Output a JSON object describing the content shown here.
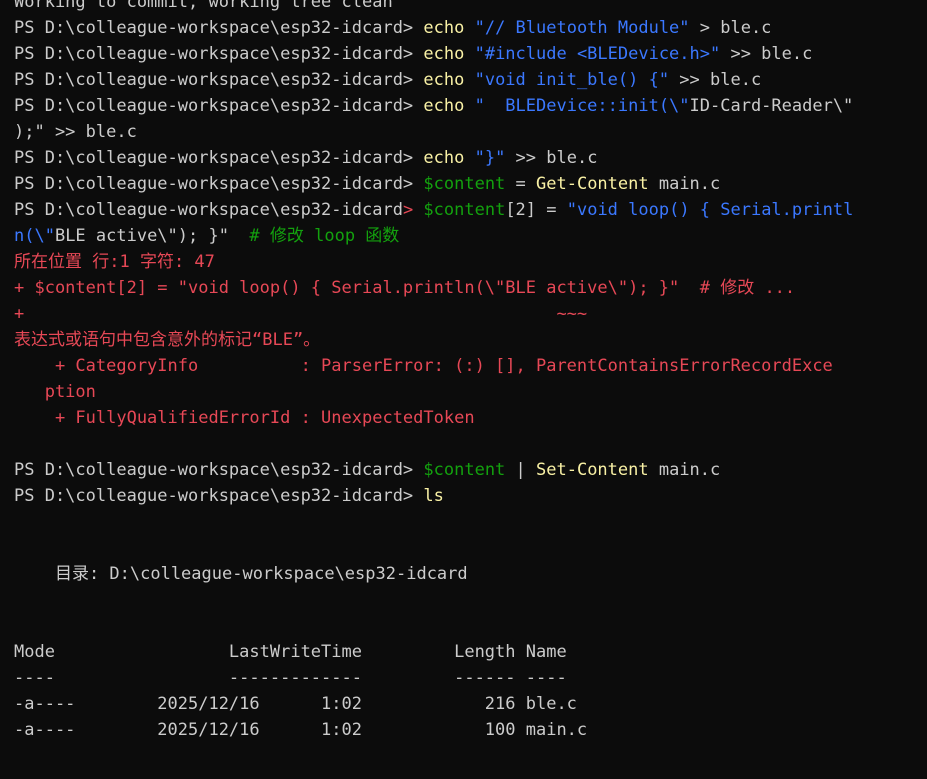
{
  "colors": {
    "background": "#0c0c0c",
    "text": "#cccccc",
    "command": "#f9f1a5",
    "string": "#3b78ff",
    "comment": "#13a10e",
    "error": "#e74856"
  },
  "lines": [
    [
      {
        "t": "Working to commit, working tree clean",
        "c": "w"
      }
    ],
    [
      {
        "t": "PS D:\\colleague-workspace\\esp32-idcard> ",
        "c": "w"
      },
      {
        "t": "echo",
        "c": "y"
      },
      {
        "t": " \"// Bluetooth Module\"",
        "c": "s"
      },
      {
        "t": " > ble.c",
        "c": "w"
      }
    ],
    [
      {
        "t": "PS D:\\colleague-workspace\\esp32-idcard> ",
        "c": "w"
      },
      {
        "t": "echo",
        "c": "y"
      },
      {
        "t": " \"#include <BLEDevice.h>\"",
        "c": "s"
      },
      {
        "t": " >> ble.c",
        "c": "w"
      }
    ],
    [
      {
        "t": "PS D:\\colleague-workspace\\esp32-idcard> ",
        "c": "w"
      },
      {
        "t": "echo",
        "c": "y"
      },
      {
        "t": " \"void init_ble() {\"",
        "c": "s"
      },
      {
        "t": " >> ble.c",
        "c": "w"
      }
    ],
    [
      {
        "t": "PS D:\\colleague-workspace\\esp32-idcard> ",
        "c": "w"
      },
      {
        "t": "echo",
        "c": "y"
      },
      {
        "t": " \"  BLEDevice::init(\\\"",
        "c": "s"
      },
      {
        "t": "ID-Card-Reader\\\"",
        "c": "w"
      }
    ],
    [
      {
        "t": ");\" >> ble.c",
        "c": "w"
      }
    ],
    [
      {
        "t": "PS D:\\colleague-workspace\\esp32-idcard> ",
        "c": "w"
      },
      {
        "t": "echo",
        "c": "y"
      },
      {
        "t": " \"}\"",
        "c": "s"
      },
      {
        "t": " >> ble.c",
        "c": "w"
      }
    ],
    [
      {
        "t": "PS D:\\colleague-workspace\\esp32-idcard> ",
        "c": "w"
      },
      {
        "t": "$content",
        "c": "g"
      },
      {
        "t": " = ",
        "c": "w"
      },
      {
        "t": "Get-Content",
        "c": "y"
      },
      {
        "t": " main.c",
        "c": "w"
      }
    ],
    [
      {
        "t": "PS D:\\colleague-workspace\\esp32-idcard",
        "c": "w"
      },
      {
        "t": "> ",
        "c": "r"
      },
      {
        "t": "$content",
        "c": "g"
      },
      {
        "t": "[2] = ",
        "c": "w"
      },
      {
        "t": "\"void loop() { Serial.printl",
        "c": "s"
      }
    ],
    [
      {
        "t": "n(\\\"",
        "c": "s"
      },
      {
        "t": "BLE active\\\"); }\"",
        "c": "w"
      },
      {
        "t": "  # 修改 loop 函数",
        "c": "g"
      }
    ],
    [
      {
        "t": "所在位置 行:1 字符: 47",
        "c": "r"
      }
    ],
    [
      {
        "t": "+ $content[2] = \"void loop() { Serial.println(\\\"BLE active\\\"); }\"  # 修改 ...",
        "c": "r"
      }
    ],
    [
      {
        "t": "+                                                    ~~~",
        "c": "r"
      }
    ],
    [
      {
        "t": "表达式或语句中包含意外的标记“BLE”。",
        "c": "r"
      }
    ],
    [
      {
        "t": "    + CategoryInfo          : ParserError: (:) [], ParentContainsErrorRecordExce",
        "c": "r"
      }
    ],
    [
      {
        "t": "   ption",
        "c": "r"
      }
    ],
    [
      {
        "t": "    + FullyQualifiedErrorId : UnexpectedToken",
        "c": "r"
      }
    ],
    [
      {
        "t": "",
        "c": "w"
      }
    ],
    [
      {
        "t": "PS D:\\colleague-workspace\\esp32-idcard> ",
        "c": "w"
      },
      {
        "t": "$content",
        "c": "g"
      },
      {
        "t": " | ",
        "c": "w"
      },
      {
        "t": "Set-Content",
        "c": "y"
      },
      {
        "t": " main.c",
        "c": "w"
      }
    ],
    [
      {
        "t": "PS D:\\colleague-workspace\\esp32-idcard> ",
        "c": "w"
      },
      {
        "t": "ls",
        "c": "y"
      }
    ],
    [
      {
        "t": "",
        "c": "w"
      }
    ],
    [
      {
        "t": "",
        "c": "w"
      }
    ],
    [
      {
        "t": "    目录: D:\\colleague-workspace\\esp32-idcard",
        "c": "w"
      }
    ],
    [
      {
        "t": "",
        "c": "w"
      }
    ],
    [
      {
        "t": "",
        "c": "w"
      }
    ],
    [
      {
        "t": "Mode                 LastWriteTime         Length Name",
        "c": "w"
      }
    ],
    [
      {
        "t": "----                 -------------         ------ ----",
        "c": "w"
      }
    ],
    [
      {
        "t": "-a----        2025/12/16      1:02            216 ble.c",
        "c": "w"
      }
    ],
    [
      {
        "t": "-a----        2025/12/16      1:02            100 main.c",
        "c": "w"
      }
    ]
  ]
}
